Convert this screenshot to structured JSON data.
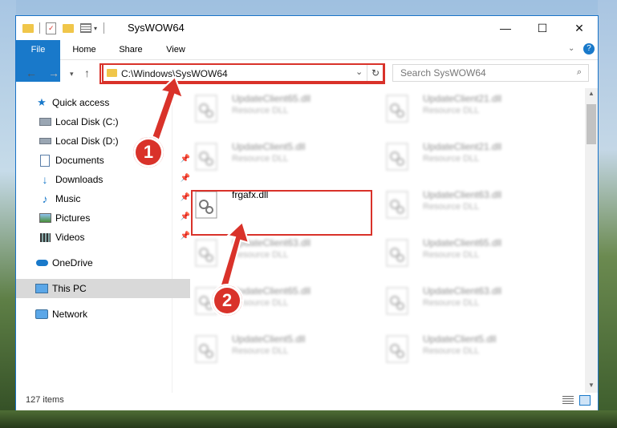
{
  "window": {
    "title": "SysWOW64",
    "controls": {
      "minimize": "—",
      "maximize": "☐",
      "close": "✕"
    }
  },
  "ribbon": {
    "tabs": [
      {
        "label": "File"
      },
      {
        "label": "Home"
      },
      {
        "label": "Share"
      },
      {
        "label": "View"
      }
    ]
  },
  "address_bar": {
    "path": "C:\\Windows\\SysWOW64"
  },
  "search": {
    "placeholder": "Search SysWOW64"
  },
  "nav": {
    "items": [
      {
        "label": "Quick access",
        "icon": "star-icon"
      },
      {
        "label": "Local Disk (C:)",
        "icon": "drive-icon"
      },
      {
        "label": "Local Disk (D:)",
        "icon": "drive-icon"
      },
      {
        "label": "Documents",
        "icon": "documents-icon"
      },
      {
        "label": "Downloads",
        "icon": "download-icon"
      },
      {
        "label": "Music",
        "icon": "music-icon"
      },
      {
        "label": "Pictures",
        "icon": "pictures-icon"
      },
      {
        "label": "Videos",
        "icon": "videos-icon"
      },
      {
        "label": "OneDrive",
        "icon": "cloud-icon"
      },
      {
        "label": "This PC",
        "icon": "computer-icon"
      },
      {
        "label": "Network",
        "icon": "network-icon"
      }
    ]
  },
  "files": {
    "left": [
      {
        "name": "UpdateClient65.dll",
        "type": "Resource DLL"
      },
      {
        "name": "UpdateClient5.dll",
        "type": "Resource DLL"
      },
      {
        "name": "frgafx.dll",
        "type": ""
      },
      {
        "name": "UpdateClient63.dll",
        "type": "Resource DLL"
      },
      {
        "name": "UpdateClient65.dll",
        "type": "Resource DLL"
      },
      {
        "name": "UpdateClient5.dll",
        "type": "Resource DLL"
      }
    ],
    "right": [
      {
        "name": "UpdateClient21.dll",
        "type": "Resource DLL"
      },
      {
        "name": "UpdateClient21.dll",
        "type": "Resource DLL"
      },
      {
        "name": "UpdateClient63.dll",
        "type": "Resource DLL"
      },
      {
        "name": "UpdateClient65.dll",
        "type": "Resource DLL"
      },
      {
        "name": "UpdateClient63.dll",
        "type": "Resource DLL"
      },
      {
        "name": "UpdateClient5.dll",
        "type": "Resource DLL"
      }
    ]
  },
  "status": {
    "item_count": "127 items"
  },
  "callouts": {
    "one": "1",
    "two": "2"
  },
  "colors": {
    "accent": "#1979ca",
    "highlight": "#d9322a"
  }
}
